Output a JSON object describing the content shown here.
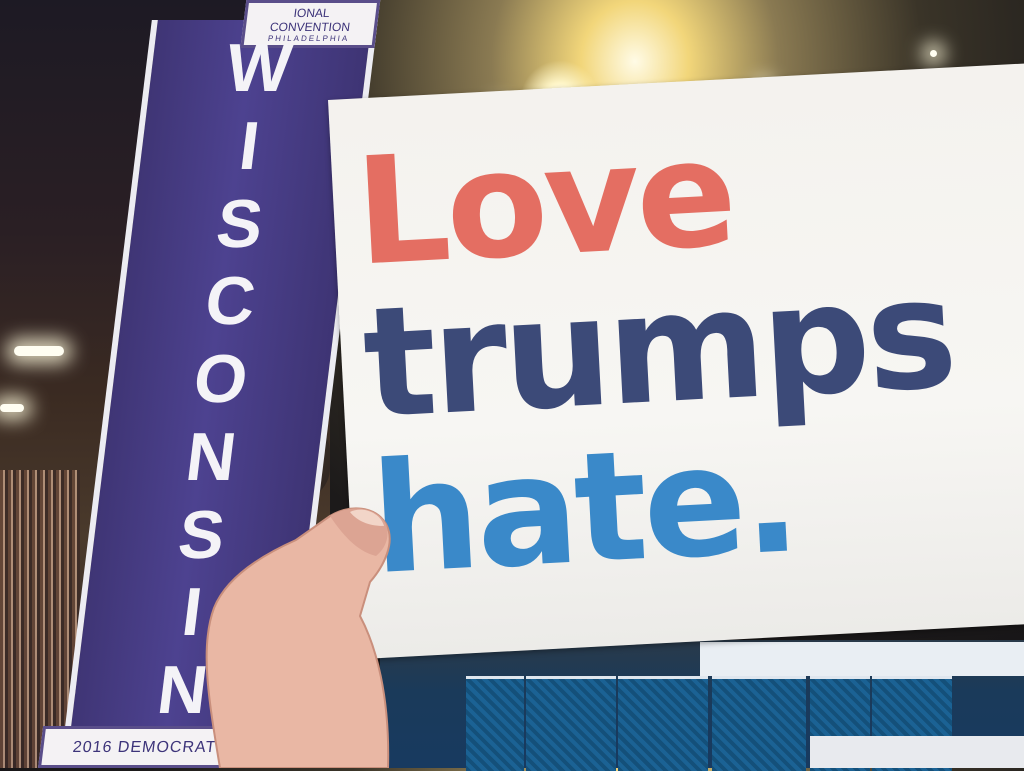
{
  "photo": {
    "standard": {
      "top_line_1": "IONAL",
      "top_line_2": "CONVENTION",
      "top_line_3": "PHILADELPHIA",
      "state_letters": [
        "W",
        "I",
        "S",
        "C",
        "O",
        "N",
        "S",
        "I",
        "N"
      ],
      "bottom_text": "2016 DEMOCRATIC"
    },
    "sign": {
      "line_1": "Love",
      "line_2": "trumps",
      "line_3": "hate.",
      "colors": {
        "line_1": "#e46e62",
        "line_2": "#3c4a78",
        "line_3": "#3a89c9"
      }
    }
  }
}
